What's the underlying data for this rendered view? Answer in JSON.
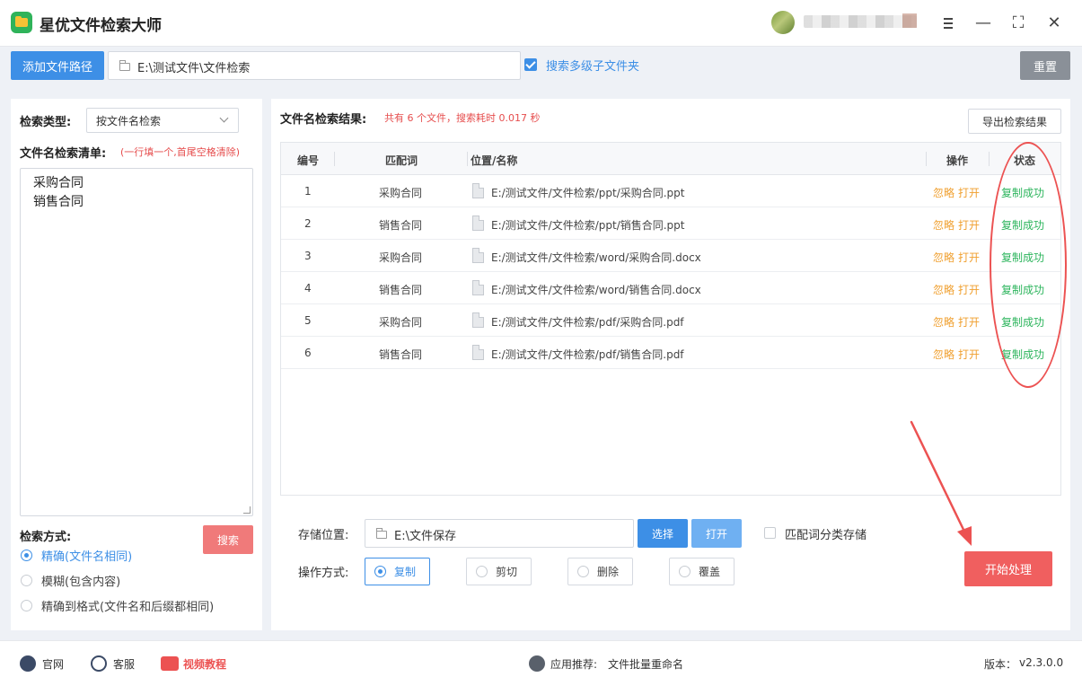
{
  "app": {
    "title": "星优文件检索大师"
  },
  "toolbar": {
    "add_path_label": "添加文件路径",
    "path_value": "E:\\测试文件\\文件检索",
    "multi_level_label": "搜索多级子文件夹",
    "reset_label": "重置"
  },
  "left": {
    "search_type_label": "检索类型:",
    "search_type_value": "按文件名检索",
    "list_label": "文件名检索清单:",
    "list_hint": "(一行填一个,首尾空格清除)",
    "keywords": [
      "采购合同",
      "销售合同"
    ],
    "search_mode_label": "检索方式:",
    "search_button": "搜索",
    "modes": [
      {
        "label": "精确(文件名相同)",
        "selected": true
      },
      {
        "label": "模糊(包含内容)",
        "selected": false
      },
      {
        "label": "精确到格式(文件名和后缀都相同)",
        "selected": false
      }
    ]
  },
  "results": {
    "title": "文件名检索结果:",
    "summary": "共有 6 个文件，搜索耗时 0.017 秒",
    "export_label": "导出检索结果",
    "headers": {
      "no": "编号",
      "match": "匹配词",
      "path": "位置/名称",
      "op": "操作",
      "status": "状态"
    },
    "rows": [
      {
        "no": "1",
        "match": "采购合同",
        "path": "E:/测试文件/文件检索/ppt/采购合同.ppt",
        "ignore": "忽略",
        "open": "打开",
        "status": "复制成功"
      },
      {
        "no": "2",
        "match": "销售合同",
        "path": "E:/测试文件/文件检索/ppt/销售合同.ppt",
        "ignore": "忽略",
        "open": "打开",
        "status": "复制成功"
      },
      {
        "no": "3",
        "match": "采购合同",
        "path": "E:/测试文件/文件检索/word/采购合同.docx",
        "ignore": "忽略",
        "open": "打开",
        "status": "复制成功"
      },
      {
        "no": "4",
        "match": "销售合同",
        "path": "E:/测试文件/文件检索/word/销售合同.docx",
        "ignore": "忽略",
        "open": "打开",
        "status": "复制成功"
      },
      {
        "no": "5",
        "match": "采购合同",
        "path": "E:/测试文件/文件检索/pdf/采购合同.pdf",
        "ignore": "忽略",
        "open": "打开",
        "status": "复制成功"
      },
      {
        "no": "6",
        "match": "销售合同",
        "path": "E:/测试文件/文件检索/pdf/销售合同.pdf",
        "ignore": "忽略",
        "open": "打开",
        "status": "复制成功"
      }
    ]
  },
  "storage": {
    "label": "存储位置:",
    "path": "E:\\文件保存",
    "choose_label": "选择",
    "open_label": "打开",
    "classify_label": "匹配词分类存储",
    "op_mode_label": "操作方式:",
    "op_modes": [
      {
        "label": "复制",
        "selected": true
      },
      {
        "label": "剪切",
        "selected": false
      },
      {
        "label": "删除",
        "selected": false
      },
      {
        "label": "覆盖",
        "selected": false
      }
    ],
    "start_label": "开始处理"
  },
  "footer": {
    "website": "官网",
    "support": "客服",
    "video": "视频教程",
    "recommend_label": "应用推荐:",
    "recommend_app": "文件批量重命名",
    "version_label": "版本：",
    "version": "v2.3.0.0"
  },
  "colors": {
    "accent": "#3d8fe6",
    "danger": "#f05f5f",
    "success": "#2db55d",
    "warning": "#f0a030"
  }
}
